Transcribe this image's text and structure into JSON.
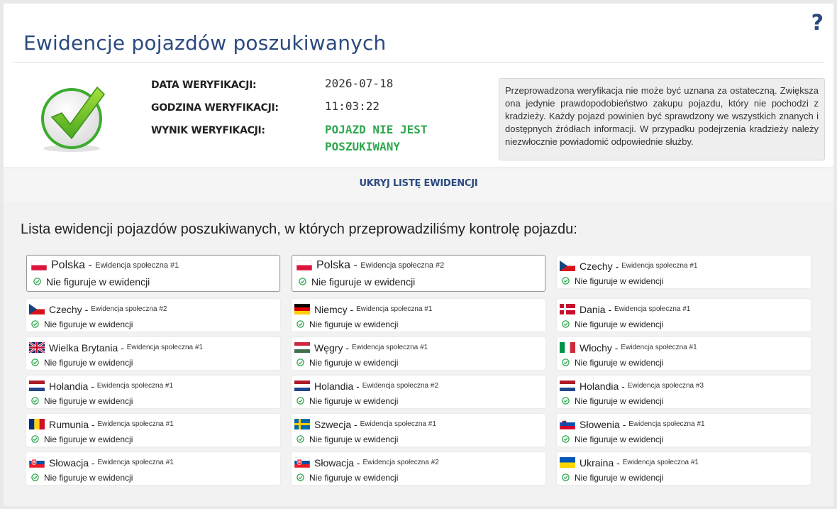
{
  "header": {
    "title": "Ewidencje pojazdów poszukiwanych",
    "help_label": "?"
  },
  "verification": {
    "date_label": "DATA WERYFIKACJI:",
    "time_label": "GODZINA WERYFIKACJI:",
    "result_label": "WYNIK WERYFIKACJI:",
    "date_value": "2026-07-18",
    "time_value": "11:03:22",
    "result_value": "POJAZD NIE JEST POSZUKIWANY",
    "result_color": "#2fa84f",
    "result_icon": "green-check-icon",
    "disclaimer": "Przeprowadzona weryfikacja nie może być uznana za ostateczną. Zwiększa ona jedynie prawdopodobieństwo zakupu pojazdu, który nie pochodzi z kradzieży. Każdy pojazd powinien być sprawdzony we wszystkich znanych i dostępnych źródłach informacji. W przypadku podejrzenia kradzieży należy niezwłocznie powiadomić odpowiednie służby."
  },
  "toggle_label": "UKRYJ LISTĘ EWIDENCJI",
  "list": {
    "heading": "Lista ewidencji pojazdów poszukiwanych, w których przeprowadziliśmy kontrolę pojazdu:",
    "status_text": "Nie figuruje w ewidencji",
    "status_icon": "check-circle-icon",
    "items": [
      {
        "country": "Polska",
        "registry": "Ewidencja społeczna #1",
        "flag": "pl",
        "selected": true
      },
      {
        "country": "Polska",
        "registry": "Ewidencja społeczna #2",
        "flag": "pl",
        "selected": true
      },
      {
        "country": "Czechy",
        "registry": "Ewidencja społeczna #1",
        "flag": "cz",
        "selected": false
      },
      {
        "country": "Czechy",
        "registry": "Ewidencja społeczna #2",
        "flag": "cz",
        "selected": false
      },
      {
        "country": "Niemcy",
        "registry": "Ewidencja społeczna #1",
        "flag": "de",
        "selected": false
      },
      {
        "country": "Dania",
        "registry": "Ewidencja społeczna #1",
        "flag": "dk",
        "selected": false
      },
      {
        "country": "Wielka Brytania",
        "registry": "Ewidencja społeczna #1",
        "flag": "gb",
        "selected": false
      },
      {
        "country": "Węgry",
        "registry": "Ewidencja społeczna #1",
        "flag": "hu",
        "selected": false
      },
      {
        "country": "Włochy",
        "registry": "Ewidencja społeczna #1",
        "flag": "it",
        "selected": false
      },
      {
        "country": "Holandia",
        "registry": "Ewidencja społeczna #1",
        "flag": "nl",
        "selected": false
      },
      {
        "country": "Holandia",
        "registry": "Ewidencja społeczna #2",
        "flag": "nl",
        "selected": false
      },
      {
        "country": "Holandia",
        "registry": "Ewidencja społeczna #3",
        "flag": "nl",
        "selected": false
      },
      {
        "country": "Rumunia",
        "registry": "Ewidencja społeczna #1",
        "flag": "ro",
        "selected": false
      },
      {
        "country": "Szwecja",
        "registry": "Ewidencja społeczna #1",
        "flag": "se",
        "selected": false
      },
      {
        "country": "Słowenia",
        "registry": "Ewidencja społeczna #1",
        "flag": "si",
        "selected": false
      },
      {
        "country": "Słowacja",
        "registry": "Ewidencja społeczna #1",
        "flag": "sk",
        "selected": false
      },
      {
        "country": "Słowacja",
        "registry": "Ewidencja społeczna #2",
        "flag": "sk",
        "selected": false
      },
      {
        "country": "Ukraina",
        "registry": "Ewidencja społeczna #1",
        "flag": "ua",
        "selected": false
      }
    ]
  },
  "colors": {
    "brand_blue": "#2b4a7e",
    "success_green": "#2fa84f"
  }
}
